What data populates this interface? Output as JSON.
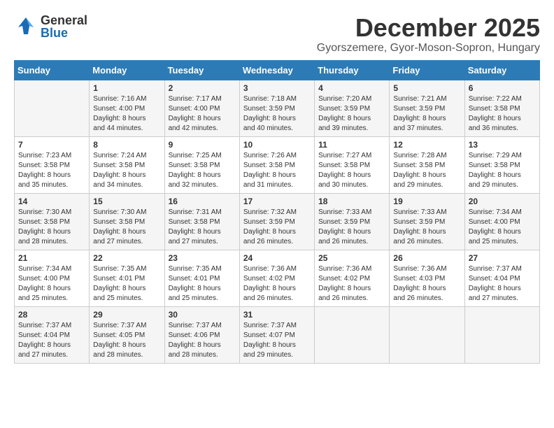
{
  "header": {
    "logo_general": "General",
    "logo_blue": "Blue",
    "title": "December 2025",
    "location": "Gyorszemere, Gyor-Moson-Sopron, Hungary"
  },
  "calendar": {
    "days_of_week": [
      "Sunday",
      "Monday",
      "Tuesday",
      "Wednesday",
      "Thursday",
      "Friday",
      "Saturday"
    ],
    "weeks": [
      [
        {
          "day": "",
          "content": ""
        },
        {
          "day": "1",
          "content": "Sunrise: 7:16 AM\nSunset: 4:00 PM\nDaylight: 8 hours\nand 44 minutes."
        },
        {
          "day": "2",
          "content": "Sunrise: 7:17 AM\nSunset: 4:00 PM\nDaylight: 8 hours\nand 42 minutes."
        },
        {
          "day": "3",
          "content": "Sunrise: 7:18 AM\nSunset: 3:59 PM\nDaylight: 8 hours\nand 40 minutes."
        },
        {
          "day": "4",
          "content": "Sunrise: 7:20 AM\nSunset: 3:59 PM\nDaylight: 8 hours\nand 39 minutes."
        },
        {
          "day": "5",
          "content": "Sunrise: 7:21 AM\nSunset: 3:59 PM\nDaylight: 8 hours\nand 37 minutes."
        },
        {
          "day": "6",
          "content": "Sunrise: 7:22 AM\nSunset: 3:58 PM\nDaylight: 8 hours\nand 36 minutes."
        }
      ],
      [
        {
          "day": "7",
          "content": "Sunrise: 7:23 AM\nSunset: 3:58 PM\nDaylight: 8 hours\nand 35 minutes."
        },
        {
          "day": "8",
          "content": "Sunrise: 7:24 AM\nSunset: 3:58 PM\nDaylight: 8 hours\nand 34 minutes."
        },
        {
          "day": "9",
          "content": "Sunrise: 7:25 AM\nSunset: 3:58 PM\nDaylight: 8 hours\nand 32 minutes."
        },
        {
          "day": "10",
          "content": "Sunrise: 7:26 AM\nSunset: 3:58 PM\nDaylight: 8 hours\nand 31 minutes."
        },
        {
          "day": "11",
          "content": "Sunrise: 7:27 AM\nSunset: 3:58 PM\nDaylight: 8 hours\nand 30 minutes."
        },
        {
          "day": "12",
          "content": "Sunrise: 7:28 AM\nSunset: 3:58 PM\nDaylight: 8 hours\nand 29 minutes."
        },
        {
          "day": "13",
          "content": "Sunrise: 7:29 AM\nSunset: 3:58 PM\nDaylight: 8 hours\nand 29 minutes."
        }
      ],
      [
        {
          "day": "14",
          "content": "Sunrise: 7:30 AM\nSunset: 3:58 PM\nDaylight: 8 hours\nand 28 minutes."
        },
        {
          "day": "15",
          "content": "Sunrise: 7:30 AM\nSunset: 3:58 PM\nDaylight: 8 hours\nand 27 minutes."
        },
        {
          "day": "16",
          "content": "Sunrise: 7:31 AM\nSunset: 3:58 PM\nDaylight: 8 hours\nand 27 minutes."
        },
        {
          "day": "17",
          "content": "Sunrise: 7:32 AM\nSunset: 3:59 PM\nDaylight: 8 hours\nand 26 minutes."
        },
        {
          "day": "18",
          "content": "Sunrise: 7:33 AM\nSunset: 3:59 PM\nDaylight: 8 hours\nand 26 minutes."
        },
        {
          "day": "19",
          "content": "Sunrise: 7:33 AM\nSunset: 3:59 PM\nDaylight: 8 hours\nand 26 minutes."
        },
        {
          "day": "20",
          "content": "Sunrise: 7:34 AM\nSunset: 4:00 PM\nDaylight: 8 hours\nand 25 minutes."
        }
      ],
      [
        {
          "day": "21",
          "content": "Sunrise: 7:34 AM\nSunset: 4:00 PM\nDaylight: 8 hours\nand 25 minutes."
        },
        {
          "day": "22",
          "content": "Sunrise: 7:35 AM\nSunset: 4:01 PM\nDaylight: 8 hours\nand 25 minutes."
        },
        {
          "day": "23",
          "content": "Sunrise: 7:35 AM\nSunset: 4:01 PM\nDaylight: 8 hours\nand 25 minutes."
        },
        {
          "day": "24",
          "content": "Sunrise: 7:36 AM\nSunset: 4:02 PM\nDaylight: 8 hours\nand 26 minutes."
        },
        {
          "day": "25",
          "content": "Sunrise: 7:36 AM\nSunset: 4:02 PM\nDaylight: 8 hours\nand 26 minutes."
        },
        {
          "day": "26",
          "content": "Sunrise: 7:36 AM\nSunset: 4:03 PM\nDaylight: 8 hours\nand 26 minutes."
        },
        {
          "day": "27",
          "content": "Sunrise: 7:37 AM\nSunset: 4:04 PM\nDaylight: 8 hours\nand 27 minutes."
        }
      ],
      [
        {
          "day": "28",
          "content": "Sunrise: 7:37 AM\nSunset: 4:04 PM\nDaylight: 8 hours\nand 27 minutes."
        },
        {
          "day": "29",
          "content": "Sunrise: 7:37 AM\nSunset: 4:05 PM\nDaylight: 8 hours\nand 28 minutes."
        },
        {
          "day": "30",
          "content": "Sunrise: 7:37 AM\nSunset: 4:06 PM\nDaylight: 8 hours\nand 28 minutes."
        },
        {
          "day": "31",
          "content": "Sunrise: 7:37 AM\nSunset: 4:07 PM\nDaylight: 8 hours\nand 29 minutes."
        },
        {
          "day": "",
          "content": ""
        },
        {
          "day": "",
          "content": ""
        },
        {
          "day": "",
          "content": ""
        }
      ]
    ]
  }
}
